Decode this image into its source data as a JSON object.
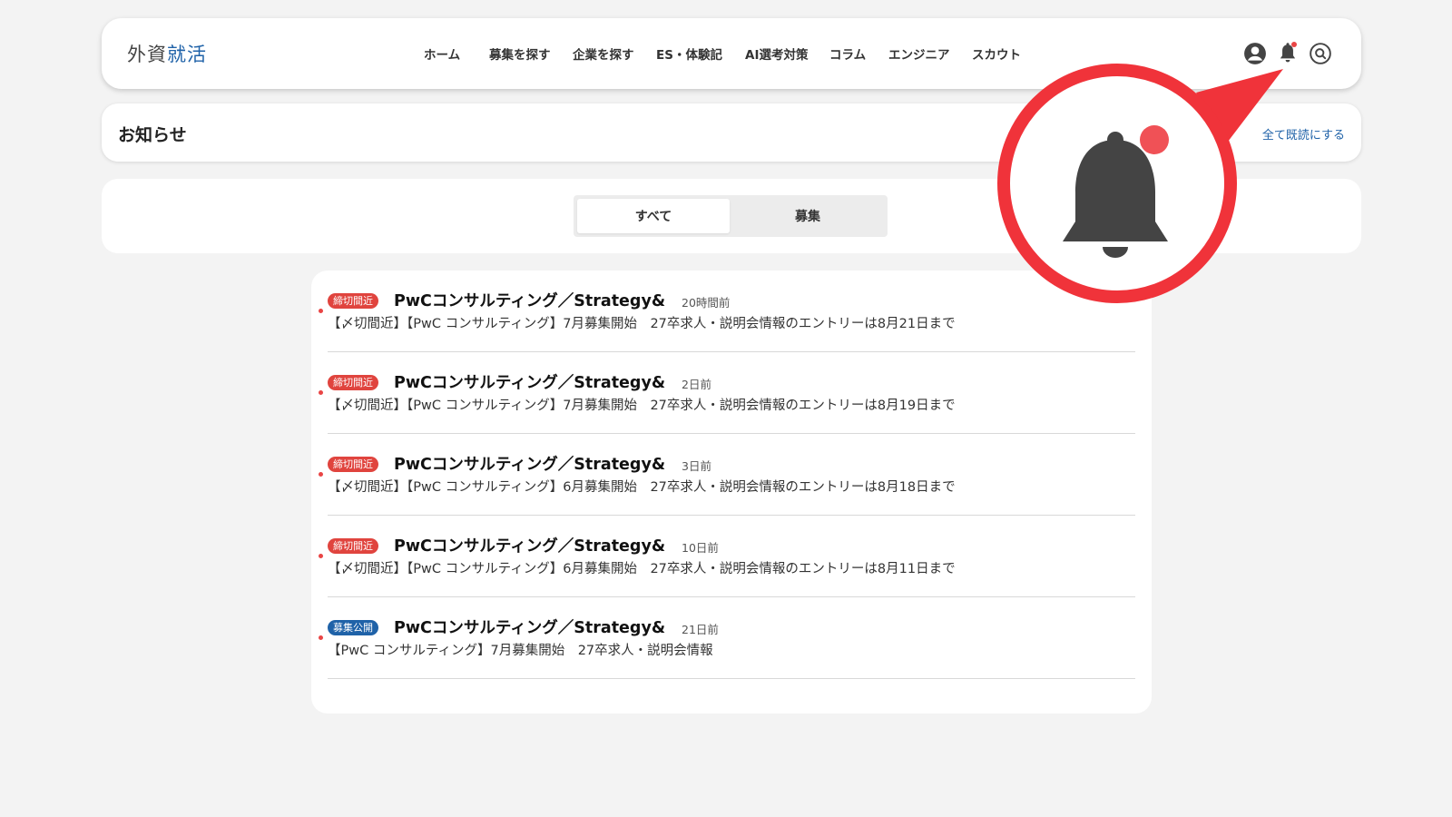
{
  "logo": {
    "part1": "外資",
    "part2": "就活"
  },
  "nav": [
    "ホーム",
    "募集を探す",
    "企業を探す",
    "ES・体験記",
    "AI選考対策",
    "コラム",
    "エンジニア",
    "スカウト"
  ],
  "header_icons": [
    "account-icon",
    "bell-icon",
    "search-icon"
  ],
  "page": {
    "title": "お知らせ",
    "mark_all_read": "全て既読にする"
  },
  "tabs": [
    {
      "label": "すべて",
      "active": true
    },
    {
      "label": "募集",
      "active": false
    }
  ],
  "notifications": [
    {
      "badge": "締切間近",
      "badge_color": "#e0443e",
      "title": "PwCコンサルティング／Strategy&",
      "time": "20時間前",
      "desc": "【〆切間近】【PwC コンサルティング】7月募集開始　27卒求人・説明会情報のエントリーは8月21日まで",
      "unread": true
    },
    {
      "badge": "締切間近",
      "badge_color": "#e0443e",
      "title": "PwCコンサルティング／Strategy&",
      "time": "2日前",
      "desc": "【〆切間近】【PwC コンサルティング】7月募集開始　27卒求人・説明会情報のエントリーは8月19日まで",
      "unread": true
    },
    {
      "badge": "締切間近",
      "badge_color": "#e0443e",
      "title": "PwCコンサルティング／Strategy&",
      "time": "3日前",
      "desc": "【〆切間近】【PwC コンサルティング】6月募集開始　27卒求人・説明会情報のエントリーは8月18日まで",
      "unread": true
    },
    {
      "badge": "締切間近",
      "badge_color": "#e0443e",
      "title": "PwCコンサルティング／Strategy&",
      "time": "10日前",
      "desc": "【〆切間近】【PwC コンサルティング】6月募集開始　27卒求人・説明会情報のエントリーは8月11日まで",
      "unread": true
    },
    {
      "badge": "募集公開",
      "badge_color": "#1f62a8",
      "title": "PwCコンサルティング／Strategy&",
      "time": "21日前",
      "desc": "【PwC コンサルティング】7月募集開始　27卒求人・説明会情報",
      "unread": true
    }
  ],
  "callout": {
    "icon": "bell-icon",
    "color": "#f0333a",
    "unread_indicator": true
  }
}
